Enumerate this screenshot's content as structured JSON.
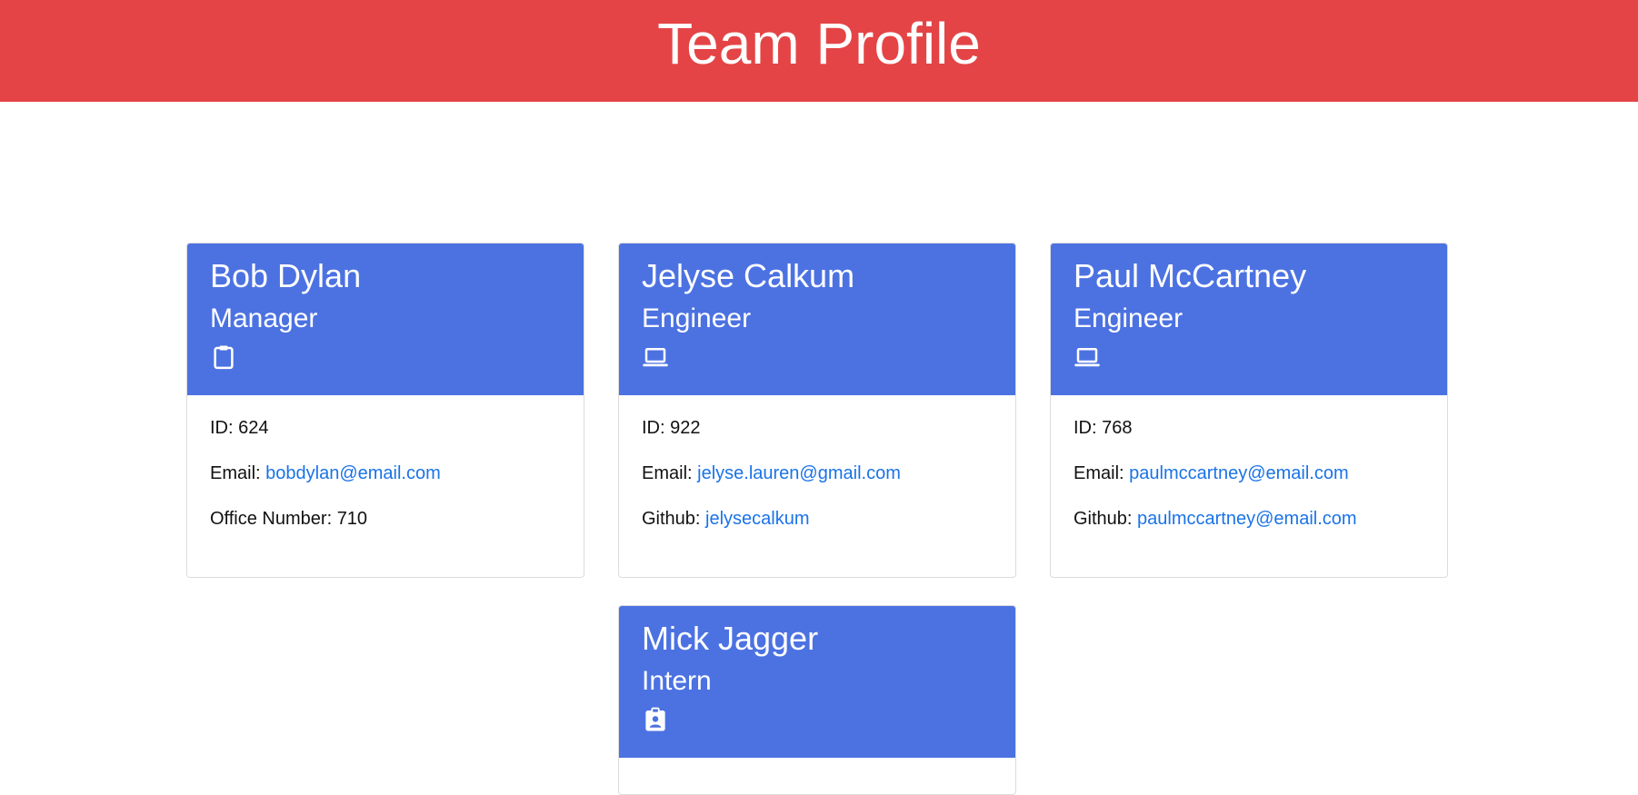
{
  "header": {
    "title": "Team Profile"
  },
  "members": [
    {
      "name": "Bob Dylan",
      "role": "Manager",
      "icon": "clipboard-icon",
      "id_label": "ID:",
      "id": "624",
      "email_label": "Email:",
      "email": "bobdylan@email.com",
      "extra_label": "Office Number:",
      "extra": "710"
    },
    {
      "name": "Jelyse Calkum",
      "role": "Engineer",
      "icon": "laptop-icon",
      "id_label": "ID:",
      "id": "922",
      "email_label": "Email:",
      "email": "jelyse.lauren@gmail.com",
      "extra_label": "Github:",
      "extra": "jelysecalkum"
    },
    {
      "name": "Paul McCartney",
      "role": "Engineer",
      "icon": "laptop-icon",
      "id_label": "ID:",
      "id": "768",
      "email_label": "Email:",
      "email": "paulmccartney@email.com",
      "extra_label": "Github:",
      "extra": "paulmccartney@email.com"
    },
    {
      "name": "Mick Jagger",
      "role": "Intern",
      "icon": "id-badge-icon"
    }
  ],
  "colors": {
    "header_bg": "#e44446",
    "card_header_bg": "#4c72e2",
    "link": "#1a73e8"
  }
}
